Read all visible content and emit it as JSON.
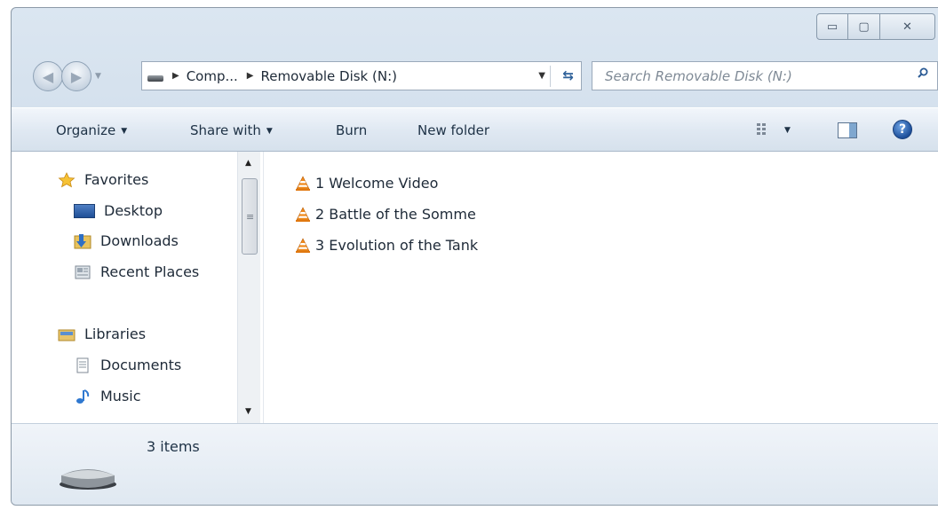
{
  "window": {
    "min_glyph": "▭",
    "max_glyph": "▢",
    "close_glyph": "✕"
  },
  "address_bar": {
    "crumbs": [
      "Comp...",
      "Removable Disk (N:)"
    ]
  },
  "search": {
    "placeholder": "Search Removable Disk (N:)"
  },
  "toolbar": {
    "organize": "Organize",
    "share_with": "Share with",
    "burn": "Burn",
    "new_folder": "New folder"
  },
  "nav_pane": {
    "favorites": "Favorites",
    "desktop": "Desktop",
    "downloads": "Downloads",
    "recent_places": "Recent Places",
    "libraries": "Libraries",
    "documents": "Documents",
    "music": "Music"
  },
  "files": [
    "1 Welcome Video",
    "2 Battle of the Somme",
    "3 Evolution of the Tank"
  ],
  "details": {
    "item_count": "3 items"
  }
}
